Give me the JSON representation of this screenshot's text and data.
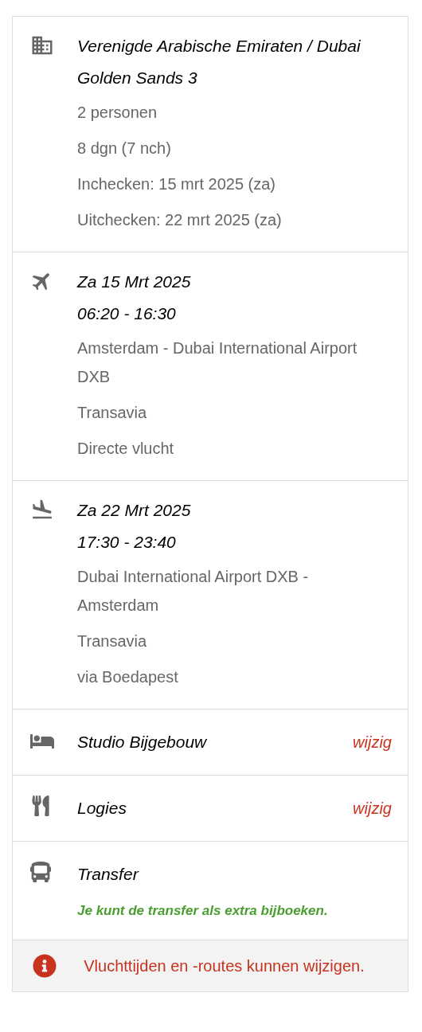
{
  "sections": [
    {
      "kind": "hotel",
      "title_lines": [
        "Verenigde Arabische Emiraten / Dubai",
        "Golden Sands 3"
      ],
      "details": [
        "2 personen",
        "8 dgn (7 nch)",
        "Inchecken: 15 mrt 2025 (za)",
        "Uitchecken: 22 mrt 2025 (za)"
      ]
    },
    {
      "kind": "outbound",
      "title_lines": [
        "Za 15 Mrt 2025",
        "06:20 - 16:30"
      ],
      "details": [
        "Amsterdam - Dubai International Airport DXB",
        "Transavia",
        "Directe vlucht"
      ]
    },
    {
      "kind": "return",
      "title_lines": [
        "Za 22 Mrt 2025",
        "17:30 - 23:40"
      ],
      "details": [
        "Dubai International Airport DXB - Amsterdam",
        "Transavia",
        "via Boedapest"
      ]
    },
    {
      "kind": "room",
      "title_lines": [
        "Studio Bijgebouw"
      ],
      "action": "wijzig"
    },
    {
      "kind": "meals",
      "title_lines": [
        "Logies"
      ],
      "action": "wijzig"
    },
    {
      "kind": "transfer",
      "title_lines": [
        "Transfer"
      ],
      "note": "Je kunt de transfer als extra bijboeken."
    }
  ],
  "notice": {
    "text": "Vluchttijden en -routes kunnen wijzigen."
  }
}
